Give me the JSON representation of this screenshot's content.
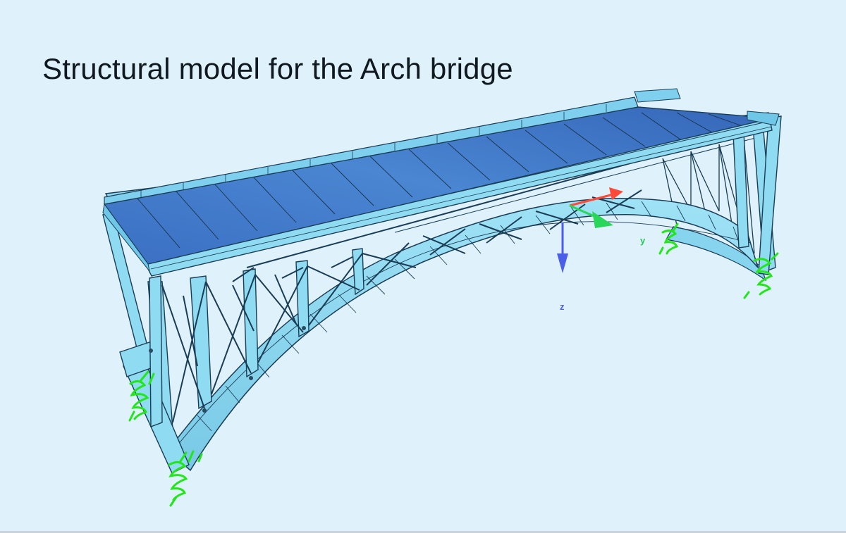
{
  "figure": {
    "title": "Structural model for the Arch bridge",
    "axes": {
      "y_label": "y",
      "z_label": "z"
    },
    "colors": {
      "background": "#dff2fc",
      "deck_top": "#3f78c8",
      "deck_edge": "#7fd0ee",
      "steel": "#8fdcf2",
      "steel_dark": "#3a8fb5",
      "outline": "#1a3c55",
      "support_springs": "#22e61a",
      "axis_x": "#ff4a3a",
      "axis_y": "#28d65a",
      "axis_z": "#4a5ee8"
    },
    "icons": {
      "supports": "spring-support-icon",
      "axes": "coordinate-triad-icon"
    }
  }
}
